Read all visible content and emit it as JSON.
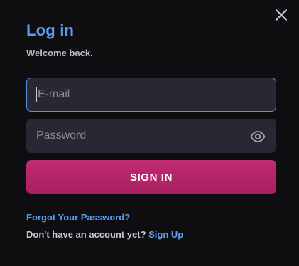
{
  "modal": {
    "title": "Log in",
    "subtitle": "Welcome back.",
    "close_icon": "close-icon"
  },
  "form": {
    "email": {
      "value": "",
      "placeholder": "E-mail"
    },
    "password": {
      "value": "",
      "placeholder": "Password",
      "toggle_icon": "eye-icon"
    },
    "submit_label": "SIGN IN"
  },
  "footer": {
    "forgot_label": "Forgot Your Password?",
    "no_account_text": "Don't have an account yet?",
    "signup_label": "Sign Up"
  },
  "colors": {
    "background": "#0e0e11",
    "accent_blue": "#5b9bf0",
    "input_bg": "#272833",
    "button_pink": "#b8266a"
  }
}
